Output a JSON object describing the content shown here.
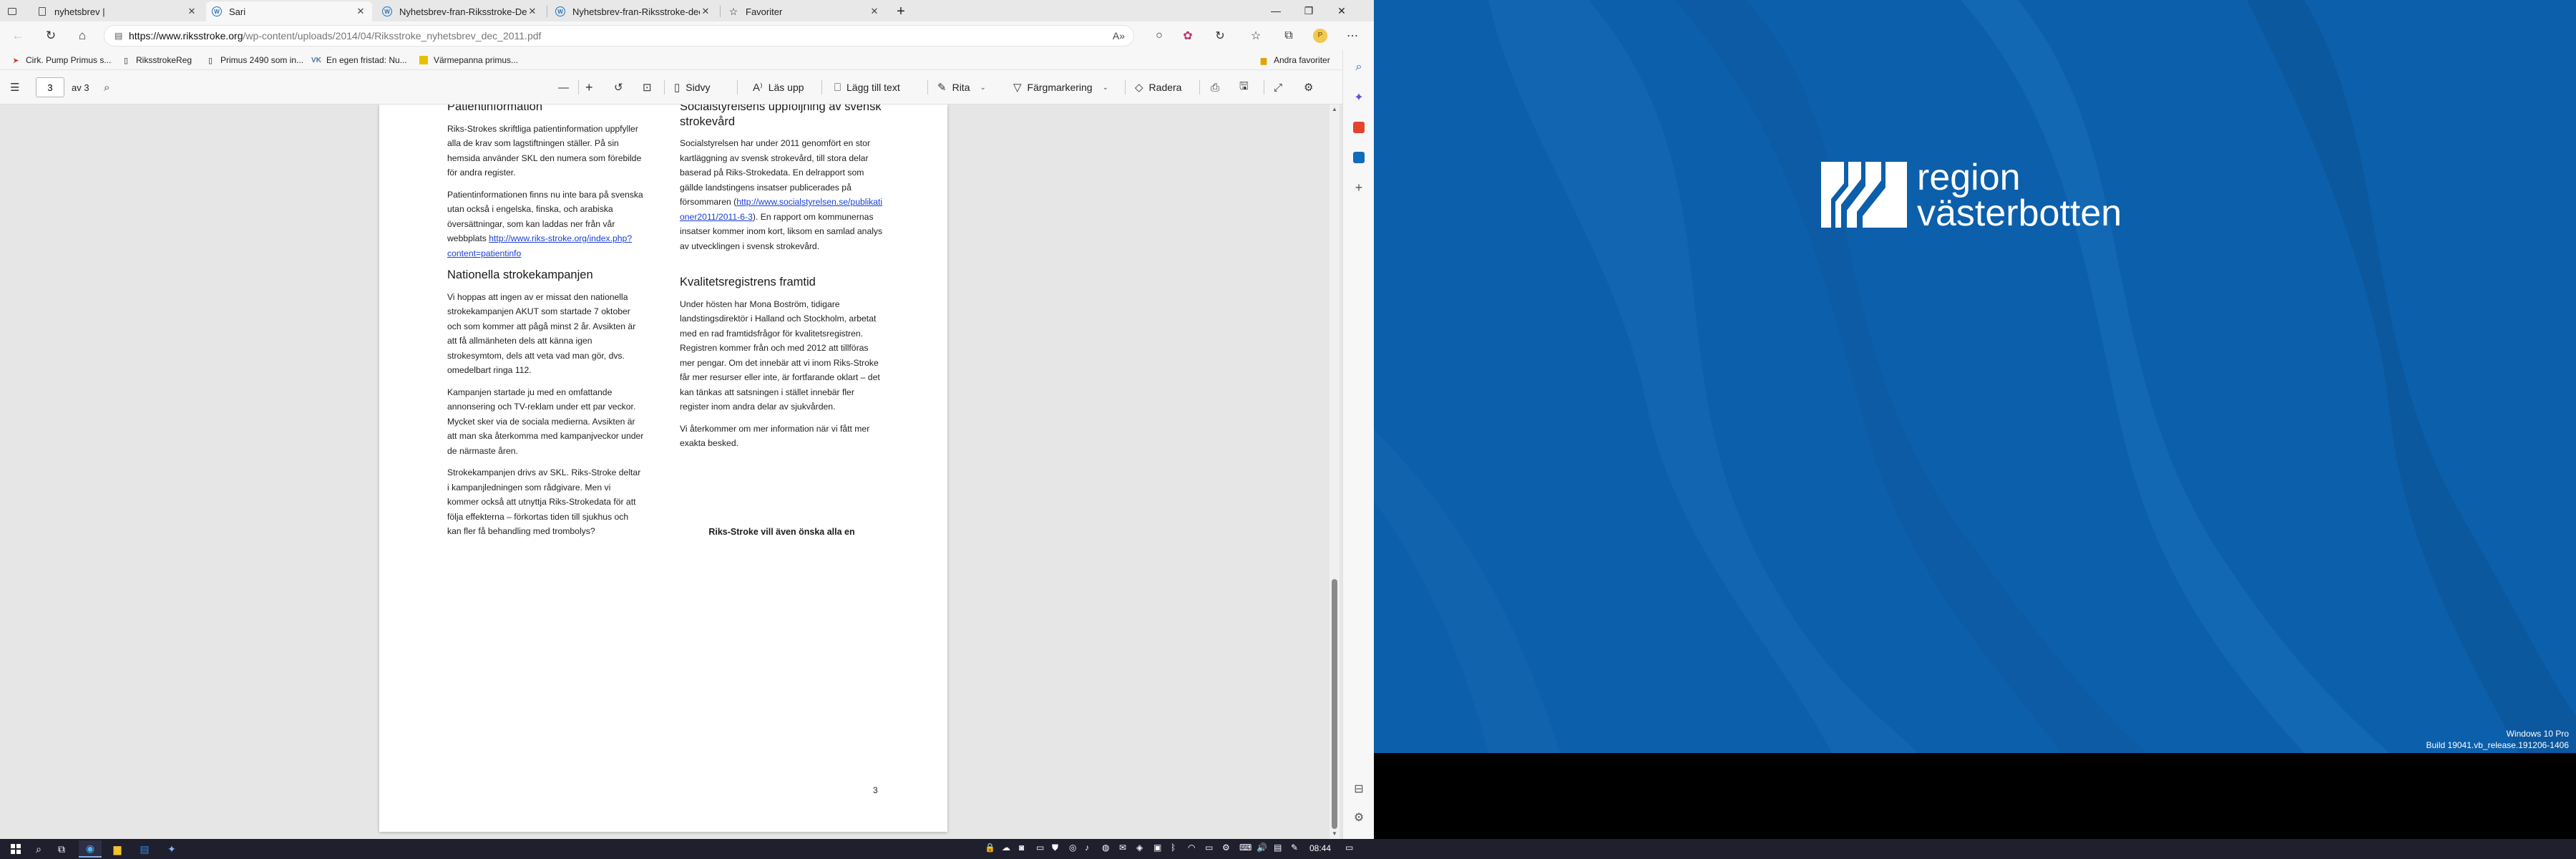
{
  "tabs": [
    {
      "title": "nyhetsbrev |",
      "icon": "page-icon",
      "active": false
    },
    {
      "title": "Sari",
      "icon": "wordpress-icon",
      "active": true
    },
    {
      "title": "Nyhetsbrev-fran-Riksstroke-Dec",
      "icon": "wordpress-icon",
      "active": false
    },
    {
      "title": "Nyhetsbrev-fran-Riksstroke-dec",
      "icon": "wordpress-icon",
      "active": false
    },
    {
      "title": "Favoriter",
      "icon": "star-icon",
      "active": false
    }
  ],
  "address": {
    "host": "https://www.riksstroke.org",
    "path": "/wp-content/uploads/2014/04/Riksstroke_nyhetsbrev_dec_2011.pdf"
  },
  "favorites": [
    {
      "label": "Cirk. Pump Primus s...",
      "icon": "red-arrow-icon"
    },
    {
      "label": "RiksstrokeReg",
      "icon": "page-icon"
    },
    {
      "label": "Primus 2490 som in...",
      "icon": "page-icon"
    },
    {
      "label": "En egen fristad: Nu...",
      "icon": "vk-icon"
    },
    {
      "label": "Värmepanna primus...",
      "icon": "yellow-icon"
    }
  ],
  "favorites_other": "Andra favoriter",
  "pdf_toolbar": {
    "page_current": "3",
    "page_total": "av 3",
    "page_view": "Sidvy",
    "read_aloud": "Läs upp",
    "add_text": "Lägg till text",
    "draw": "Rita",
    "highlight": "Färgmarkering",
    "erase": "Radera"
  },
  "pdf": {
    "left_col": {
      "h1": "Patientinformation",
      "p1": "Riks-Strokes skriftliga patientinformation uppfyller alla de krav som lagstiftningen ställer. På sin hemsida använder SKL den numera som förebilde för andra register.",
      "p2_pre": "Patientinformationen finns nu inte bara på svenska utan också i engelska, finska, och arabiska översättningar, som kan laddas ner från vår webbplats ",
      "p2_link": "http://www.riks-stroke.org/index.php?content=patientinfo",
      "h2": "Nationella strokekampanjen",
      "p3": "Vi hoppas att ingen av er missat den nationella strokekampanjen AKUT som startade 7 oktober och som kommer att pågå minst 2 år. Avsikten är att få allmänheten dels att känna igen strokesymtom, dels att veta vad man gör, dvs. omedelbart ringa 112.",
      "p4": "Kampanjen startade ju med en omfattande annonsering och TV-reklam under ett par veckor. Mycket sker via de sociala medierna. Avsikten är att man ska återkomma med kampanjveckor under de närmaste åren.",
      "p5": "Strokekampanjen drivs av SKL. Riks-Stroke deltar i kampanjledningen som rådgivare. Men vi kommer också att utnyttja Riks-Strokedata för att följa effekterna – förkortas tiden till sjukhus och kan fler få behandling med trombolys?"
    },
    "right_col": {
      "h1": "Socialstyrelsens uppföljning av svensk strokevård",
      "p1_pre": "Socialstyrelsen har under 2011 genomfört en stor kartläggning av svensk strokevård, till stora delar baserad på Riks-Strokedata. En delrapport som gällde landstingens insatser publicerades på försommaren (",
      "p1_link": "http://www.socialstyrelsen.se/publikationer2011/2011-6-3",
      "p1_post": "). En rapport om kommunernas insatser kommer inom kort, liksom en samlad analys av utvecklingen i svensk strokevård.",
      "h2": "Kvalitetsregistrens framtid",
      "p2": "Under hösten har Mona Boström, tidigare landstingsdirektör i Halland och Stockholm, arbetat med en rad framtidsfrågor för kvalitetsregistren. Registren kommer från och med 2012 att tillföras mer pengar. Om det innebär att vi inom Riks-Stroke får mer resurser eller inte, är fortfarande oklart – det kan tänkas att satsningen i stället innebär fler register inom andra delar av sjukvården.",
      "p3": "Vi återkommer om mer information när vi fått mer exakta besked.",
      "closing": "Riks-Stroke vill även önska alla en"
    },
    "page_number": "3"
  },
  "scroll": {
    "thumb_start_fraction": 0.65,
    "thumb_size_fraction": 0.35
  },
  "desktop": {
    "logo_line1": "region",
    "logo_line2": "västerbotten",
    "watermark_line1": "Windows 10 Pro",
    "watermark_line2": "Build 19041.vb_release.191206-1406"
  },
  "taskbar": {
    "clock": "08:44"
  },
  "colors": {
    "accent": "#0b5fab",
    "link": "#1a3fd6",
    "taskbar": "#1f1f2e"
  }
}
